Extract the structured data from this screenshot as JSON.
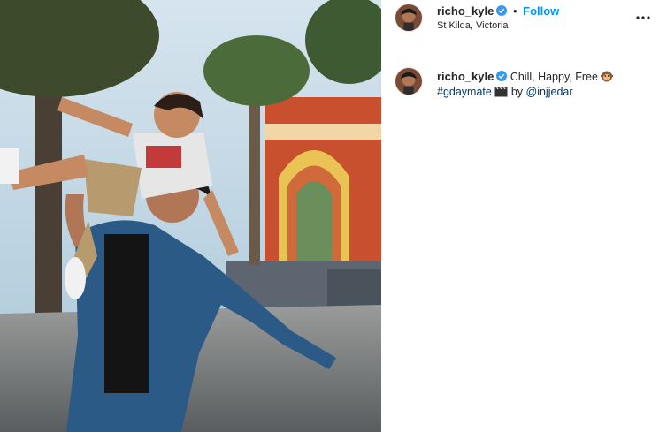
{
  "post": {
    "photo_alt": "Man carrying child on shoulders near palm trees",
    "photo_icon": "photo-image"
  },
  "header": {
    "username": "richo_kyle",
    "separator": "•",
    "follow_label": "Follow",
    "location": "St Kilda, Victoria",
    "verified_icon": "verified-badge-icon",
    "more_icon": "more-options-icon"
  },
  "caption": {
    "username": "richo_kyle",
    "text": "Chill, Happy, Free",
    "emoji_1": "monkey-face-emoji",
    "hashtag": "#gdaymate",
    "emoji_2": "clapper-board-emoji",
    "by_text": "by",
    "mention": "@injjedar"
  },
  "colors": {
    "link_blue": "#0095f6",
    "hashtag_blue": "#00376b",
    "text": "#262626",
    "verified": "#3897f0"
  }
}
